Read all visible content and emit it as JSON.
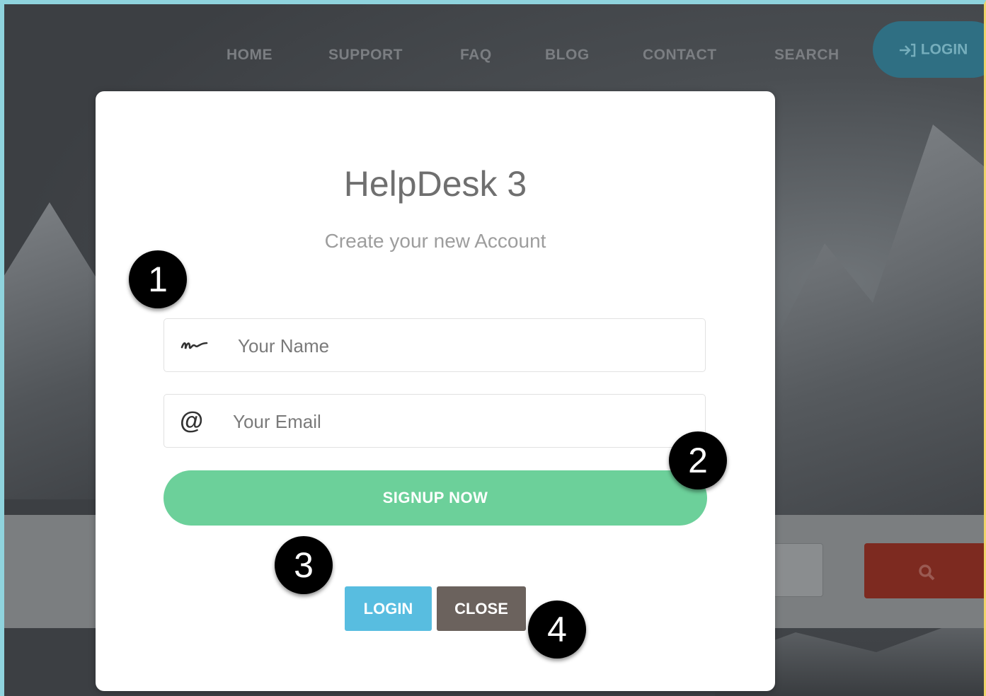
{
  "nav": {
    "items": [
      "HOME",
      "SUPPORT",
      "FAQ",
      "BLOG",
      "CONTACT",
      "SEARCH"
    ],
    "login_label": "LOGIN"
  },
  "modal": {
    "title": "HelpDesk 3",
    "subtitle": "Create your new Account",
    "name_placeholder": "Your Name",
    "email_placeholder": "Your Email",
    "signup_label": "SIGNUP NOW",
    "login_label": "LOGIN",
    "close_label": "CLOSE"
  },
  "callouts": [
    "1",
    "2",
    "3",
    "4"
  ],
  "colors": {
    "signup": "#6cd09a",
    "login_button": "#58bde0",
    "close_button": "#6b625d",
    "search_button": "#7d2a20"
  },
  "icons": {
    "name_field": "signature-icon",
    "email_field": "at-icon",
    "nav_login": "login-arrow-icon",
    "search": "search-icon"
  }
}
